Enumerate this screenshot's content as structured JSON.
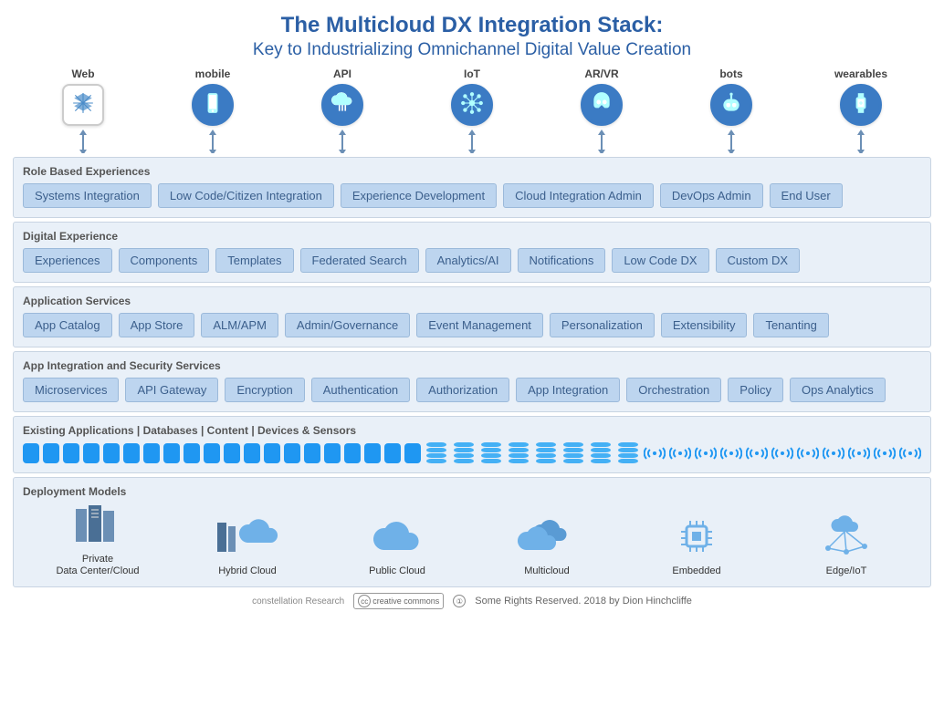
{
  "title": "The Multicloud DX Integration Stack:",
  "subtitle": "Key to Industrializing Omnichannel Digital Value Creation",
  "channels": [
    {
      "label": "Web",
      "icon": "web"
    },
    {
      "label": "mobile",
      "icon": "mobile"
    },
    {
      "label": "API",
      "icon": "api"
    },
    {
      "label": "IoT",
      "icon": "iot"
    },
    {
      "label": "AR/VR",
      "icon": "arvr"
    },
    {
      "label": "bots",
      "icon": "bots"
    },
    {
      "label": "wearables",
      "icon": "wearables"
    }
  ],
  "layers": [
    {
      "title": "Role Based Experiences",
      "items": [
        "Systems Integration",
        "Low Code/Citizen Integration",
        "Experience Development",
        "Cloud Integration Admin",
        "DevOps Admin",
        "End User"
      ]
    },
    {
      "title": "Digital Experience",
      "items": [
        "Experiences",
        "Components",
        "Templates",
        "Federated Search",
        "Analytics/AI",
        "Notifications",
        "Low Code DX",
        "Custom DX"
      ]
    },
    {
      "title": "Application Services",
      "items": [
        "App Catalog",
        "App Store",
        "ALM/APM",
        "Admin/Governance",
        "Event Management",
        "Personalization",
        "Extensibility",
        "Tenanting"
      ]
    },
    {
      "title": "App Integration and Security Services",
      "items": [
        "Microservices",
        "API Gateway",
        "Encryption",
        "Authentication",
        "Authorization",
        "App Integration",
        "Orchestration",
        "Policy",
        "Ops Analytics"
      ]
    }
  ],
  "existing_title": "Existing Applications | Databases | Content | Devices & Sensors",
  "existing": {
    "apps": 20,
    "databases": 8,
    "sensors": 11
  },
  "deployment_title": "Deployment Models",
  "deployments": [
    {
      "label": "Private\nData Center/Cloud",
      "icon": "private"
    },
    {
      "label": "Hybrid Cloud",
      "icon": "hybrid"
    },
    {
      "label": "Public Cloud",
      "icon": "public"
    },
    {
      "label": "Multicloud",
      "icon": "multi"
    },
    {
      "label": "Embedded",
      "icon": "embedded"
    },
    {
      "label": "Edge/IoT",
      "icon": "edge"
    }
  ],
  "footer": {
    "brand": "constellation Research",
    "cc": "creative commons",
    "rights": "Some Rights Reserved. 2018 by Dion Hinchcliffe"
  }
}
